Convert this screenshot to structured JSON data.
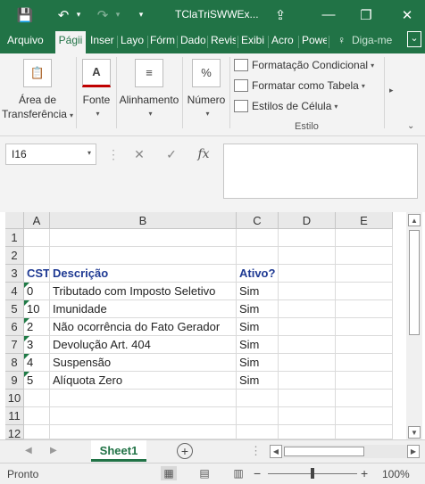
{
  "window": {
    "title": "TClaTriSWWEx...",
    "save_glyph": "💾",
    "undo_glyph": "↶",
    "redo_glyph": "↷",
    "caret": "▾",
    "ribbon_display_glyph": "⇪",
    "minimize_glyph": "—",
    "restore_glyph": "❐",
    "close_glyph": "✕"
  },
  "tabs": [
    "Arquivo",
    "Págii",
    "Inser",
    "Layo",
    "Fórm",
    "Dado",
    "Revis",
    "Exibi",
    "Acro",
    "Powe"
  ],
  "tell_me": "Diga-me",
  "tell_me_glyph": "♀",
  "collapse_glyph": "⌄",
  "ribbon": {
    "clipboard": {
      "line1": "Área de",
      "line2": "Transferência",
      "glyph": "📋"
    },
    "font": {
      "label": "Fonte",
      "glyph": "A"
    },
    "alignment": {
      "label": "Alinhamento",
      "glyph": "≡"
    },
    "number": {
      "label": "Número",
      "glyph": "%"
    },
    "styles": {
      "conditional": "Formatação Condicional",
      "as_table": "Formatar como Tabela",
      "cell_styles": "Estilos de Célula",
      "group_label": "Estilo"
    },
    "dropdown_glyph": "▾",
    "more_glyph": "▸"
  },
  "formula_bar": {
    "name_box": "I16",
    "dropdown_glyph": "▾",
    "cancel_glyph": "✕",
    "enter_glyph": "✓",
    "fx_glyph": "fx",
    "formula": ""
  },
  "grid": {
    "columns": [
      "A",
      "B",
      "C",
      "D",
      "E"
    ],
    "rows": [
      "1",
      "2",
      "3",
      "4",
      "5",
      "6",
      "7",
      "8",
      "9",
      "10",
      "11",
      "12"
    ],
    "header": {
      "cst": "CST",
      "descricao": "Descrição",
      "ativo": "Ativo?"
    },
    "data": [
      {
        "cst": "0",
        "descricao": "Tributado com Imposto Seletivo",
        "ativo": "Sim"
      },
      {
        "cst": "10",
        "descricao": "Imunidade",
        "ativo": "Sim"
      },
      {
        "cst": "2",
        "descricao": "Não ocorrência do Fato Gerador",
        "ativo": "Sim"
      },
      {
        "cst": "3",
        "descricao": "Devolução Art. 404",
        "ativo": "Sim"
      },
      {
        "cst": "4",
        "descricao": "Suspensão",
        "ativo": "Sim"
      },
      {
        "cst": "5",
        "descricao": "Alíquota Zero",
        "ativo": "Sim"
      }
    ]
  },
  "scroll": {
    "up": "▲",
    "down": "▼",
    "left": "◀",
    "right": "▶"
  },
  "sheets": {
    "active": "Sheet1",
    "prev": "◀",
    "next": "▶",
    "add": "+"
  },
  "status": {
    "text": "Pronto",
    "view_normal": "▦",
    "view_layout": "▤",
    "view_break": "▥",
    "zoom_out": "−",
    "zoom_in": "+",
    "zoom": "100%"
  },
  "colors": {
    "brand": "#217346",
    "header_text": "#1f3a93"
  }
}
